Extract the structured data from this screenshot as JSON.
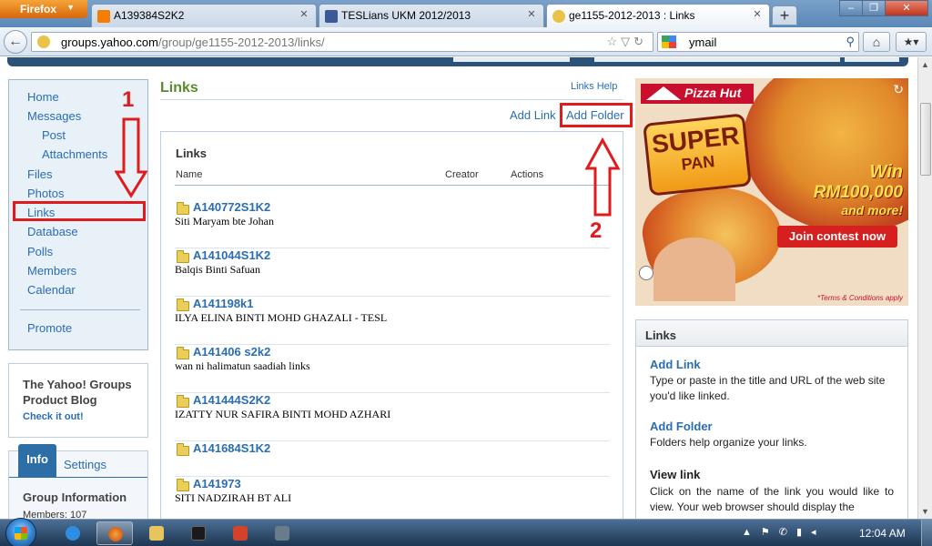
{
  "browser": {
    "app_button": "Firefox",
    "tabs": [
      {
        "title": "A139384S2K2"
      },
      {
        "title": "TESLians UKM 2012/2013"
      },
      {
        "title": "ge1155-2012-2013 : Links"
      }
    ],
    "url_domain": "groups.yahoo.com",
    "url_path": "/group/ge1155-2012-2013/links/",
    "search_text": "ymail"
  },
  "leftnav": {
    "items": [
      "Home",
      "Messages",
      "Post",
      "Attachments",
      "Files",
      "Photos",
      "Links",
      "Database",
      "Polls",
      "Members",
      "Calendar",
      "Promote"
    ]
  },
  "blog": {
    "title": "The Yahoo! Groups Product Blog",
    "link": "Check it out!"
  },
  "info": {
    "tab_info": "Info",
    "tab_settings": "Settings",
    "group_info_title": "Group Information",
    "members": "Members: 107"
  },
  "main": {
    "title": "Links",
    "help_link": "Links Help",
    "add_link": "Add Link",
    "add_folder": "Add Folder",
    "panel_title": "Links",
    "columns": [
      "Name",
      "Creator",
      "Actions"
    ],
    "rows": [
      {
        "name": "A140772S1K2",
        "desc": "Siti Maryam bte Johan"
      },
      {
        "name": "A141044S1K2",
        "desc": "Balqis Binti Safuan"
      },
      {
        "name": "A141198k1",
        "desc": "ILYA ELINA BINTI MOHD GHAZALI - TESL"
      },
      {
        "name": "A141406 s2k2",
        "desc": "wan ni halimatun saadiah links"
      },
      {
        "name": "A141444S2K2",
        "desc": "IZATTY NUR SAFIRA BINTI MOHD AZHARI"
      },
      {
        "name": "A141684S1K2",
        "desc": ""
      },
      {
        "name": "A141973",
        "desc": "SITI NADZIRAH BT ALI"
      }
    ]
  },
  "annotations": {
    "num1": "1",
    "num2": "2"
  },
  "ad": {
    "brand": "Pizza Hut",
    "super": "SUPER",
    "pan": "PAN",
    "win1": "Win",
    "win2": "RM100,000",
    "win3": "and more!",
    "cta": "Join contest now",
    "terms": "*Terms & Conditions apply"
  },
  "help": {
    "header": "Links",
    "add_link_title": "Add Link",
    "add_link_text": "Type or paste in the title and URL of the web site you'd like linked.",
    "add_folder_title": "Add Folder",
    "add_folder_text": "Folders help organize your links.",
    "view_link_title": "View link",
    "view_link_text": "Click on the name of the link you would like to view. Your web browser should display the"
  },
  "taskbar": {
    "clock": "12:04 AM"
  },
  "colors": {
    "link_blue": "#2a6db3",
    "title_green": "#5b8a2d",
    "annotation_red": "#e01b1b"
  }
}
